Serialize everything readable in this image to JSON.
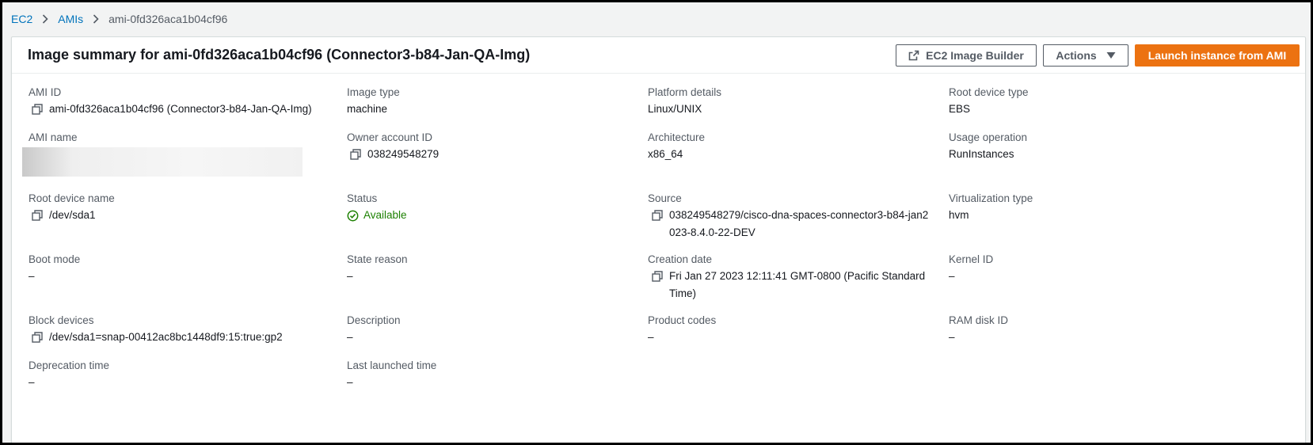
{
  "breadcrumb": {
    "items": [
      "EC2",
      "AMIs"
    ],
    "current": "ami-0fd326aca1b04cf96"
  },
  "header": {
    "title": "Image summary for ami-0fd326aca1b04cf96 (Connector3-b84-Jan-QA-Img)",
    "builder_label": "EC2 Image Builder",
    "actions_label": "Actions",
    "launch_label": "Launch instance from AMI"
  },
  "colors": {
    "primary": "#ec7211",
    "link": "#0073bb",
    "success": "#1d8102"
  },
  "details": {
    "ami_id": {
      "label": "AMI ID",
      "value": "ami-0fd326aca1b04cf96 (Connector3-b84-Jan-QA-Img)"
    },
    "image_type": {
      "label": "Image type",
      "value": "machine"
    },
    "platform_details": {
      "label": "Platform details",
      "value": "Linux/UNIX"
    },
    "root_device_type": {
      "label": "Root device type",
      "value": "EBS"
    },
    "ami_name": {
      "label": "AMI name"
    },
    "owner_account_id": {
      "label": "Owner account ID",
      "value": "038249548279"
    },
    "architecture": {
      "label": "Architecture",
      "value": "x86_64"
    },
    "usage_operation": {
      "label": "Usage operation",
      "value": "RunInstances"
    },
    "root_device_name": {
      "label": "Root device name",
      "value": "/dev/sda1"
    },
    "status": {
      "label": "Status",
      "value": "Available"
    },
    "source": {
      "label": "Source",
      "value": "038249548279/cisco-dna-spaces-connector3-b84-jan2023-8.4.0-22-DEV"
    },
    "virtualization_type": {
      "label": "Virtualization type",
      "value": "hvm"
    },
    "boot_mode": {
      "label": "Boot mode",
      "value": "–"
    },
    "state_reason": {
      "label": "State reason",
      "value": "–"
    },
    "creation_date": {
      "label": "Creation date",
      "value": "Fri Jan 27 2023 12:11:41 GMT-0800 (Pacific Standard Time)"
    },
    "kernel_id": {
      "label": "Kernel ID",
      "value": "–"
    },
    "block_devices": {
      "label": "Block devices",
      "value": "/dev/sda1=snap-00412ac8bc1448df9:15:true:gp2"
    },
    "description": {
      "label": "Description",
      "value": "–"
    },
    "product_codes": {
      "label": "Product codes",
      "value": "–"
    },
    "ram_disk_id": {
      "label": "RAM disk ID",
      "value": "–"
    },
    "deprecation_time": {
      "label": "Deprecation time",
      "value": "–"
    },
    "last_launched_time": {
      "label": "Last launched time",
      "value": "–"
    }
  }
}
